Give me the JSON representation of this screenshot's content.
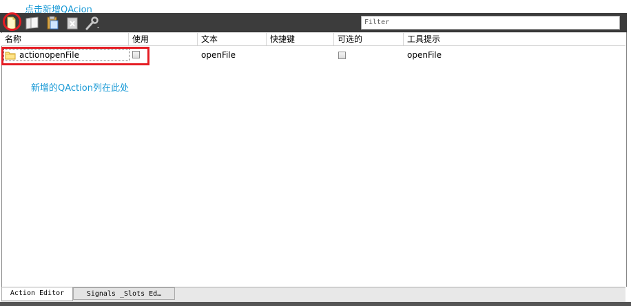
{
  "annotations": {
    "top": "点击新增QAcion",
    "middle": "新增的QAction列在此处"
  },
  "toolbar": {
    "buttons": [
      {
        "icon": "new-action-icon"
      },
      {
        "icon": "copy-action-icon"
      },
      {
        "icon": "paste-action-icon"
      },
      {
        "icon": "delete-action-icon"
      },
      {
        "icon": "configure-wrench-icon"
      }
    ],
    "filter_placeholder": "Filter"
  },
  "table": {
    "headers": [
      "名称",
      "使用",
      "文本",
      "快捷键",
      "可选的",
      "工具提示"
    ],
    "rows": [
      {
        "name": "actionopenFile",
        "used": false,
        "text": "openFile",
        "shortcut": "",
        "checkable": false,
        "tooltip": "openFile"
      }
    ]
  },
  "tabs": [
    {
      "label": "Action Editor",
      "active": true
    },
    {
      "label": "Signals _Slots Ed…",
      "active": false
    }
  ],
  "colors": {
    "annotation": "#1a9ad6",
    "highlight": "#e51c23",
    "toolbar_bg": "#3c3c3c"
  }
}
